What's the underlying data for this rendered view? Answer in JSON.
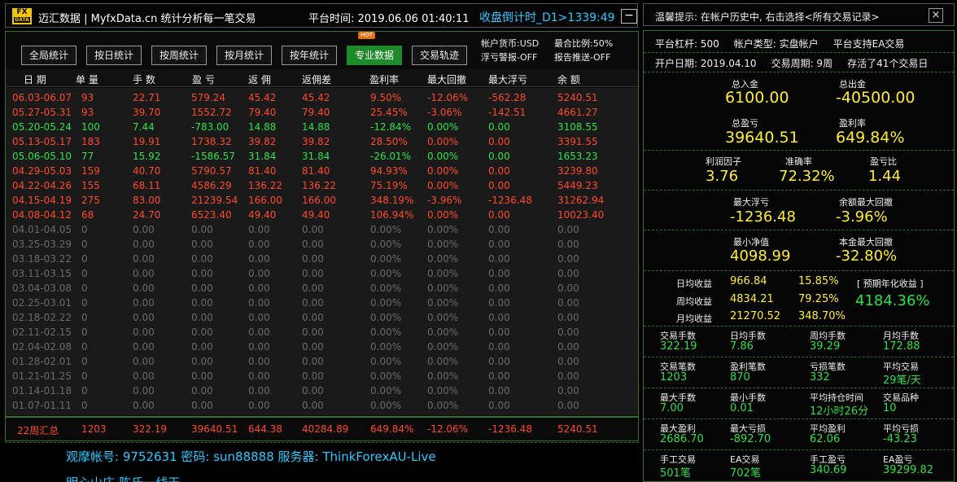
{
  "header": {
    "logo_top": "FX",
    "logo_bottom": "DATA",
    "app_title": "迈汇数据 | MyfxData.cn  统计分析每一笔交易",
    "platform_time": "平台时间: 2019.06.06 01:40:11",
    "countdown": "收盘倒计时_D1>1339:49",
    "minimize": "−"
  },
  "nav": {
    "buttons": [
      "全局统计",
      "按日统计",
      "按周统计",
      "按月统计",
      "按年统计",
      "专业数据",
      "交易轨迹"
    ],
    "active_index": 5,
    "hot_badge": "HOT",
    "account_currency": "帐户货币:USD",
    "max_ratio": "最合比例:50%",
    "floating_alert": "浮亏警报-OFF",
    "report_push": "报告推送-OFF"
  },
  "table": {
    "headers": [
      "日 期",
      "单 量",
      "手 数",
      "盈 亏",
      "返 佣",
      "返佣差",
      "盈利率",
      "最大回撤",
      "最大浮亏",
      "余 额"
    ],
    "rows": [
      {
        "c": [
          "06.03-06.07",
          "93",
          "22.71",
          "579.24",
          "45.42",
          "45.42",
          "9.50%",
          "-12.06%",
          "-562.28",
          "5240.51"
        ],
        "s": "red"
      },
      {
        "c": [
          "05.27-05.31",
          "93",
          "39.70",
          "1552.72",
          "79.40",
          "79.40",
          "25.45%",
          "-3.06%",
          "-142.51",
          "4661.27"
        ],
        "s": "red"
      },
      {
        "c": [
          "05.20-05.24",
          "100",
          "7.44",
          "-783.00",
          "14.88",
          "14.88",
          "-12.84%",
          "0.00%",
          "0.00",
          "3108.55"
        ],
        "s": "green"
      },
      {
        "c": [
          "05.13-05.17",
          "183",
          "19.91",
          "1738.32",
          "39.82",
          "39.82",
          "28.50%",
          "0.00%",
          "0.00",
          "3391.55"
        ],
        "s": "red"
      },
      {
        "c": [
          "05.06-05.10",
          "77",
          "15.92",
          "-1586.57",
          "31.84",
          "31.84",
          "-26.01%",
          "0.00%",
          "0.00",
          "1653.23"
        ],
        "s": "green"
      },
      {
        "c": [
          "04.29-05.03",
          "159",
          "40.70",
          "5790.57",
          "81.40",
          "81.40",
          "94.93%",
          "0.00%",
          "0.00",
          "3239.80"
        ],
        "s": "red"
      },
      {
        "c": [
          "04.22-04.26",
          "155",
          "68.11",
          "4586.29",
          "136.22",
          "136.22",
          "75.19%",
          "0.00%",
          "0.00",
          "5449.23"
        ],
        "s": "red"
      },
      {
        "c": [
          "04.15-04.19",
          "275",
          "83.00",
          "21239.54",
          "166.00",
          "166.00",
          "348.19%",
          "-3.96%",
          "-1236.48",
          "31262.94"
        ],
        "s": "red"
      },
      {
        "c": [
          "04.08-04.12",
          "68",
          "24.70",
          "6523.40",
          "49.40",
          "49.40",
          "106.94%",
          "0.00%",
          "0.00",
          "10023.40"
        ],
        "s": "red"
      },
      {
        "c": [
          "04.01-04.05",
          "0",
          "0.00",
          "0.00",
          "0.00",
          "0.00",
          "0.00%",
          "0.00%",
          "0.00",
          "0.00"
        ],
        "s": "gray"
      },
      {
        "c": [
          "03.25-03.29",
          "0",
          "0.00",
          "0.00",
          "0.00",
          "0.00",
          "0.00%",
          "0.00%",
          "0.00",
          "0.00"
        ],
        "s": "gray"
      },
      {
        "c": [
          "03.18-03.22",
          "0",
          "0.00",
          "0.00",
          "0.00",
          "0.00",
          "0.00%",
          "0.00%",
          "0.00",
          "0.00"
        ],
        "s": "gray"
      },
      {
        "c": [
          "03.11-03.15",
          "0",
          "0.00",
          "0.00",
          "0.00",
          "0.00",
          "0.00%",
          "0.00%",
          "0.00",
          "0.00"
        ],
        "s": "gray"
      },
      {
        "c": [
          "03.04-03.08",
          "0",
          "0.00",
          "0.00",
          "0.00",
          "0.00",
          "0.00%",
          "0.00%",
          "0.00",
          "0.00"
        ],
        "s": "gray"
      },
      {
        "c": [
          "02.25-03.01",
          "0",
          "0.00",
          "0.00",
          "0.00",
          "0.00",
          "0.00%",
          "0.00%",
          "0.00",
          "0.00"
        ],
        "s": "gray"
      },
      {
        "c": [
          "02.18-02.22",
          "0",
          "0.00",
          "0.00",
          "0.00",
          "0.00",
          "0.00%",
          "0.00%",
          "0.00",
          "0.00"
        ],
        "s": "gray"
      },
      {
        "c": [
          "02.11-02.15",
          "0",
          "0.00",
          "0.00",
          "0.00",
          "0.00",
          "0.00%",
          "0.00%",
          "0.00",
          "0.00"
        ],
        "s": "gray"
      },
      {
        "c": [
          "02.04-02.08",
          "0",
          "0.00",
          "0.00",
          "0.00",
          "0.00",
          "0.00%",
          "0.00%",
          "0.00",
          "0.00"
        ],
        "s": "gray"
      },
      {
        "c": [
          "01.28-02.01",
          "0",
          "0.00",
          "0.00",
          "0.00",
          "0.00",
          "0.00%",
          "0.00%",
          "0.00",
          "0.00"
        ],
        "s": "gray"
      },
      {
        "c": [
          "01.21-01.25",
          "0",
          "0.00",
          "0.00",
          "0.00",
          "0.00",
          "0.00%",
          "0.00%",
          "0.00",
          "0.00"
        ],
        "s": "gray"
      },
      {
        "c": [
          "01.14-01.18",
          "0",
          "0.00",
          "0.00",
          "0.00",
          "0.00",
          "0.00%",
          "0.00%",
          "0.00",
          "0.00"
        ],
        "s": "gray"
      },
      {
        "c": [
          "01.07-01.11",
          "0",
          "0.00",
          "0.00",
          "0.00",
          "0.00",
          "0.00%",
          "0.00%",
          "0.00",
          "0.00"
        ],
        "s": "gray"
      }
    ],
    "summary": [
      "22周汇总",
      "1203",
      "322.19",
      "39640.51",
      "644.38",
      "40284.89",
      "649.84%",
      "-12.06%",
      "-1236.48",
      "5240.51"
    ]
  },
  "footer": {
    "account_line": "观摩帐号: 9752631     密码: sun88888     服务器: ThinkForexAU-Live",
    "second_line": "明心山庄-陈氏一线天"
  },
  "colors": {
    "positive_row": "#ff4a2a",
    "negative_row": "#2ee04a",
    "empty_row": "#6a6a6a",
    "accent_blue": "#2ec9ff",
    "value_yellow": "#ffee2e",
    "active_green": "#1e8a2a"
  },
  "right": {
    "notice": "温馨提示: 在帐户历史中, 右击选择<所有交易记录>",
    "close": "×",
    "info1": [
      "平台杠杆: 500",
      "帐户类型: 实盘帐户",
      "平台支持EA交易"
    ],
    "info2": [
      "开户日期: 2019.04.10",
      "交易周期: 9周",
      "存活了41个交易日"
    ],
    "deposit_label": "总入金",
    "deposit": "6100.00",
    "withdraw_label": "总出金",
    "withdraw": "-40500.00",
    "profit_label": "总盈亏",
    "profit": "39640.51",
    "rate_label": "盈利率",
    "rate": "649.84%",
    "pf_label": "利润因子",
    "pf": "3.76",
    "acc_label": "准确率",
    "acc": "72.32%",
    "pl_label": "盈亏比",
    "pl": "1.44",
    "maxfloat_label": "最大浮亏",
    "maxfloat": "-1236.48",
    "baldd_label": "余额最大回撤",
    "baldd": "-3.96%",
    "minnet_label": "最小净值",
    "minnet": "4098.99",
    "capdd_label": "本金最大回撤",
    "capdd": "-32.80%",
    "daily_label": "日均收益",
    "daily_val": "966.84",
    "daily_pct": "15.85%",
    "weekly_label": "周均收益",
    "weekly_val": "4834.21",
    "weekly_pct": "79.25%",
    "monthly_label": "月均收益",
    "monthly_val": "21270.52",
    "monthly_pct": "348.70%",
    "proj_label": "[ 预期年化收益 ]",
    "proj_val": "4184.36%",
    "grid": [
      [
        [
          "交易手数",
          "322.19"
        ],
        [
          "日均手数",
          "7.86"
        ],
        [
          "周均手数",
          "39.29"
        ],
        [
          "月均手数",
          "172.88"
        ]
      ],
      [
        [
          "交易笔数",
          "1203"
        ],
        [
          "盈利笔数",
          "870"
        ],
        [
          "亏损笔数",
          "332"
        ],
        [
          "平均交易",
          "29笔/天"
        ]
      ],
      [
        [
          "最大手数",
          "7.00"
        ],
        [
          "最小手数",
          "0.01"
        ],
        [
          "平均持仓时间",
          "12小时26分"
        ],
        [
          "交易品种",
          "10"
        ]
      ],
      [
        [
          "最大盈利",
          "2686.70"
        ],
        [
          "最大亏损",
          "-892.70"
        ],
        [
          "平均盈利",
          "62.06"
        ],
        [
          "平均亏损",
          "-43.23"
        ]
      ],
      [
        [
          "手工交易",
          "501笔"
        ],
        [
          "EA交易",
          "702笔"
        ],
        [
          "手工盈亏",
          "340.69"
        ],
        [
          "EA盈亏",
          "39299.82"
        ]
      ]
    ]
  }
}
